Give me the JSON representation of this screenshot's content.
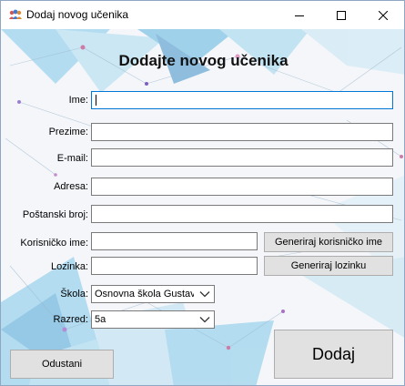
{
  "window": {
    "title": "Dodaj novog učenika",
    "icons": {
      "app": "users-icon",
      "minimize": "minimize-icon",
      "maximize": "maximize-icon",
      "close": "close-icon"
    }
  },
  "form": {
    "heading": "Dodajte novog učenika",
    "labels": {
      "ime": "Ime:",
      "prezime": "Prezime:",
      "email": "E-mail:",
      "adresa": "Adresa:",
      "postanski_broj": "Poštanski broj:",
      "korisnicko_ime": "Korisničko ime:",
      "lozinka": "Lozinka:",
      "skola": "Škola:",
      "razred": "Razred:"
    },
    "values": {
      "ime": "",
      "prezime": "",
      "email": "",
      "adresa": "",
      "postanski_broj": "",
      "korisnicko_ime": "",
      "lozinka": ""
    },
    "skola_selected": "Osnovna škola Gustav I",
    "razred_selected": "5a",
    "buttons": {
      "generate_username": "Generiraj korisničko ime",
      "generate_password": "Generiraj lozinku",
      "cancel": "Odustani",
      "add": "Dodaj"
    }
  }
}
